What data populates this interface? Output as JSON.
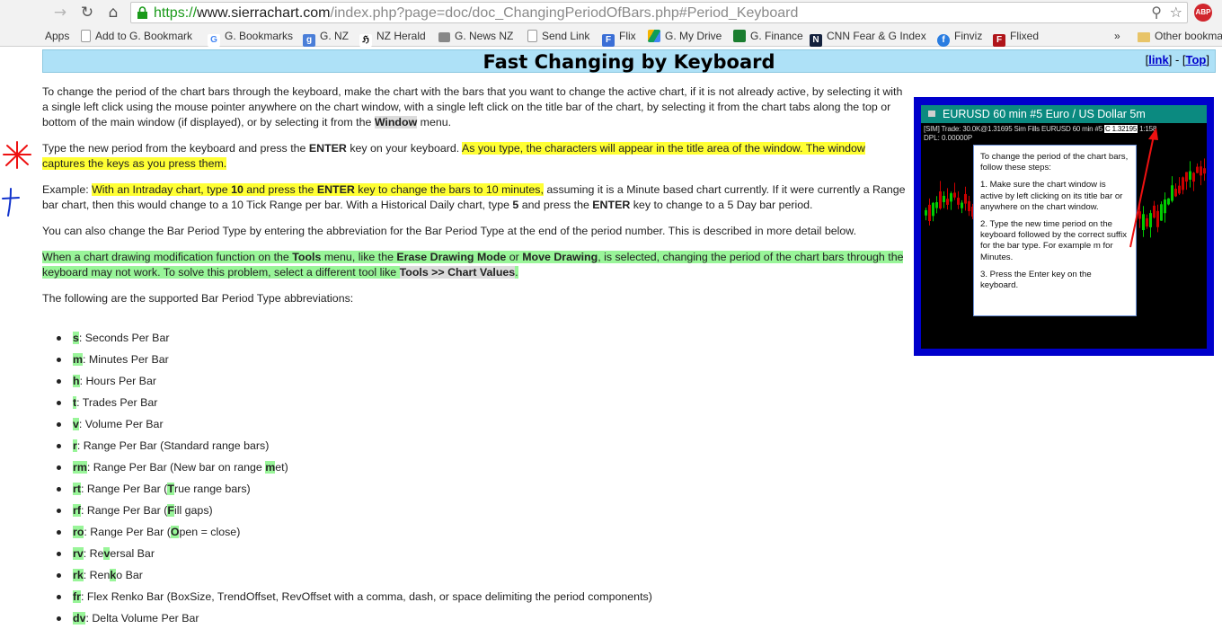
{
  "browser": {
    "url_scheme": "https://",
    "url_host": "www.sierrachart.com",
    "url_path": "/index.php?page=doc/doc_ChangingPeriodOfBars.php#Period_Keyboard",
    "abp_label": "ABP"
  },
  "bookmarks": {
    "items": [
      {
        "label": "Apps"
      },
      {
        "label": "Add to G. Bookmark"
      },
      {
        "label": "G. Bookmarks"
      },
      {
        "label": "G. NZ"
      },
      {
        "label": "NZ Herald"
      },
      {
        "label": "G. News NZ"
      },
      {
        "label": "Send Link"
      },
      {
        "label": "Flix"
      },
      {
        "label": "G. My Drive"
      },
      {
        "label": "G. Finance"
      },
      {
        "label": "CNN Fear & G Index"
      },
      {
        "label": "Finviz"
      },
      {
        "label": "Flixed"
      }
    ],
    "overflow": "»",
    "other": "Other bookmarks"
  },
  "header": {
    "title": "Fast Changing by Keyboard",
    "link_label": "link",
    "top_label": "Top",
    "separator": " - "
  },
  "paragraphs": {
    "p1": {
      "a": "To change the period of the chart bars through the keyboard, make the chart with the bars that you want to change the active chart, if it is not already active, by selecting it with a single left click using the mouse pointer anywhere on the chart window, with a single left click on the title bar of the chart, by selecting it from the chart tabs along the top or bottom of the main window (if displayed), or by selecting it from the ",
      "code": "Window",
      "b": " menu."
    },
    "p2": {
      "a": "Type the new period from the keyboard and press the ",
      "key": "ENTER",
      "b": " key on your keyboard. ",
      "hl": "As you type, the characters will appear in the title area of the window. The window captures the keys as you press them."
    },
    "p3": {
      "a": "Example: ",
      "hl1": "With an Intraday chart, type ",
      "hl_num": "10",
      "hl2": " and press the ",
      "hl_key": "ENTER",
      "hl3": " key to change the bars to 10 minutes,",
      "b": " assuming it is a Minute based chart currently. If it were currently a Range bar chart, then this would change to a 10 Tick Range per bar. With a Historical Daily chart, type ",
      "num5": "5",
      "c": " and press the ",
      "key2": "ENTER",
      "d": " key to change to a 5 Day bar period."
    },
    "p4": "You can also change the Bar Period Type by entering the abbreviation for the Bar Period Type at the end of the period number. This is described in more detail below.",
    "p5": {
      "a": "When a chart drawing modification function on the ",
      "tools": "Tools",
      "b": " menu, like the ",
      "erase": "Erase Drawing Mode",
      "c": " or ",
      "move": "Move Drawing",
      "d": ", is selected, changing the period of the chart bars through the keyboard may not work. To solve this problem, select a different tool like ",
      "code": "Tools >> Chart Values",
      "e": "."
    },
    "p6": "The following are the supported Bar Period Type abbreviations:"
  },
  "abbreviations": [
    {
      "abbr": "s",
      "desc": ": Seconds Per Bar"
    },
    {
      "abbr": "m",
      "desc": ": Minutes Per Bar"
    },
    {
      "abbr": "h",
      "desc": ": Hours Per Bar"
    },
    {
      "abbr": "t",
      "desc": ": Trades Per Bar"
    },
    {
      "abbr": "v",
      "desc": ": Volume Per Bar"
    },
    {
      "abbr": "r",
      "desc": ": Range Per Bar (Standard range bars)"
    },
    {
      "abbr": "rm",
      "d1": ": Range Per Bar (New bar on range ",
      "k": "m",
      "d2": "et)"
    },
    {
      "abbr": "rt",
      "d1": ": Range Per Bar (",
      "k": "T",
      "d2": "rue range bars)"
    },
    {
      "abbr": "rf",
      "d1": ": Range Per Bar (",
      "k": "F",
      "d2": "ill gaps)"
    },
    {
      "abbr": "ro",
      "d1": ": Range Per Bar (",
      "k": "O",
      "d2": "pen = close)"
    },
    {
      "abbr": "rv",
      "d1": ": Re",
      "k": "v",
      "d2": "ersal Bar"
    },
    {
      "abbr": "rk",
      "d1": ": Ren",
      "k": "k",
      "d2": "o Bar"
    },
    {
      "abbr": "fr",
      "desc": ": Flex Renko Bar (BoxSize, TrendOffset, RevOffset with a comma, dash, or space delimiting the period components)"
    },
    {
      "abbr": "dv",
      "desc": ": Delta Volume Per Bar"
    }
  ],
  "chart_window": {
    "title": "EURUSD  60 min   #5  Euro / US Dollar  5m",
    "status_a": "[SIM]  Trade: 30.0K@1.31695  Sim Fills  EURUSD  60 min  #5 ",
    "status_last": "C 1.32195",
    "status_b": " 1:158",
    "status2": "DPL: 0.00000P",
    "tooltip": {
      "intro": "To change the period of the chart bars, follow these steps:",
      "step1": "1. Make sure the chart window is active by left clicking on its title bar or anywhere on the chart window.",
      "step2": "2. Type the new time period on the keyboard followed by the correct suffix for the bar type. For example m for Minutes.",
      "step3": "3. Press the Enter key on the keyboard."
    }
  },
  "colors": {
    "highlight_yellow": "#ffff33",
    "highlight_green": "#99f599",
    "header_bg": "#aee1f7",
    "chart_frame": "#0000cc",
    "chart_title_bg": "#0b8a80",
    "bar_up": "#00cc00",
    "bar_down": "#cc0000",
    "annotation_red": "#ee1111",
    "annotation_blue": "#1133cc"
  }
}
